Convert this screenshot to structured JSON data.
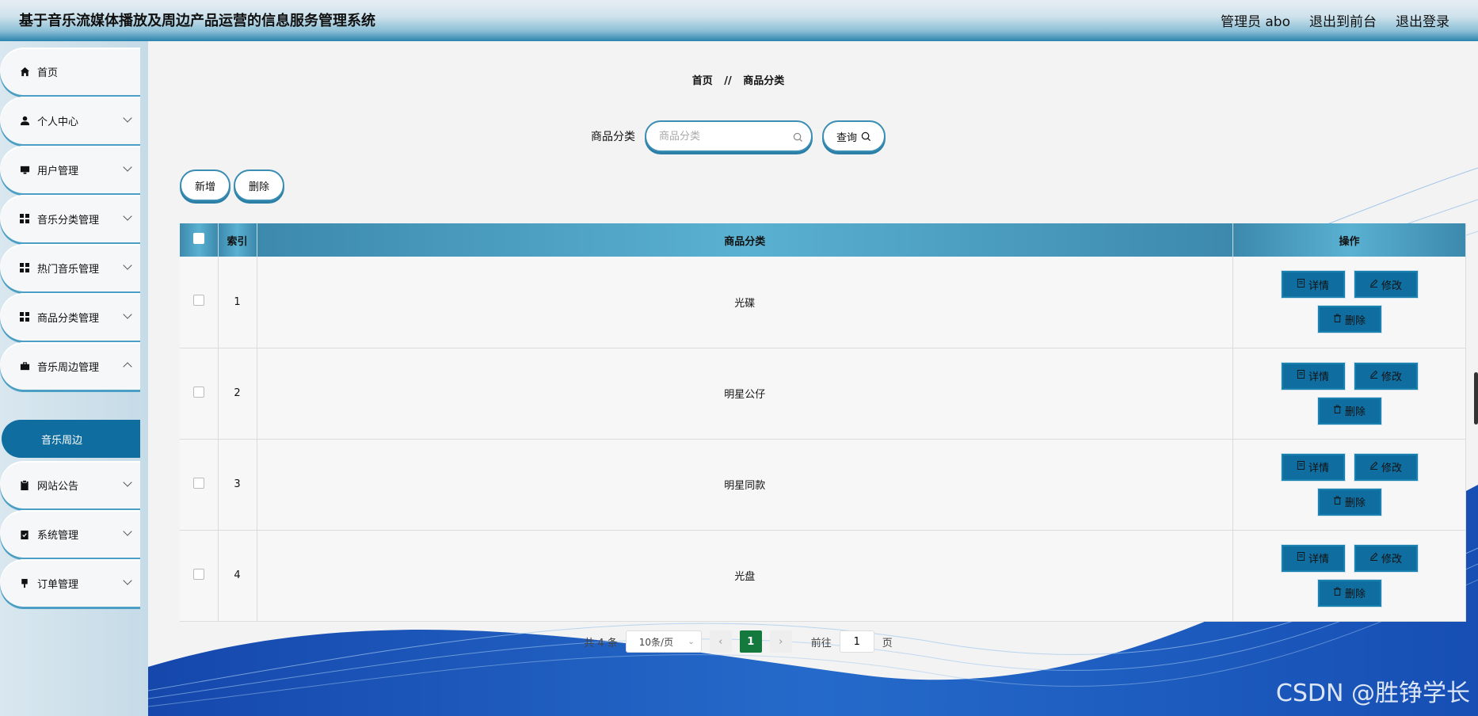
{
  "header": {
    "title": "基于音乐流媒体播放及周边产品运营的信息服务管理系统",
    "user": "管理员 abo",
    "to_front": "退出到前台",
    "logout": "退出登录"
  },
  "sidebar": {
    "items": [
      {
        "label": "首页",
        "icon": "home-icon"
      },
      {
        "label": "个人中心",
        "icon": "user-icon"
      },
      {
        "label": "用户管理",
        "icon": "monitor-icon"
      },
      {
        "label": "音乐分类管理",
        "icon": "grid-icon"
      },
      {
        "label": "热门音乐管理",
        "icon": "grid-icon"
      },
      {
        "label": "商品分类管理",
        "icon": "grid-icon"
      },
      {
        "label": "音乐周边管理",
        "icon": "briefcase-icon"
      },
      {
        "label": "网站公告",
        "icon": "clipboard-icon"
      },
      {
        "label": "系统管理",
        "icon": "clipboard-check-icon"
      },
      {
        "label": "订单管理",
        "icon": "pin-icon"
      }
    ],
    "active_sub": "音乐周边"
  },
  "breadcrumb": {
    "home": "首页",
    "separator": "//",
    "current": "商品分类"
  },
  "search": {
    "label": "商品分类",
    "placeholder": "商品分类",
    "button": "查询"
  },
  "actions": {
    "add": "新增",
    "delete": "删除"
  },
  "table": {
    "headers": {
      "index": "索引",
      "category": "商品分类",
      "ops": "操作"
    },
    "rows": [
      {
        "index": "1",
        "category": "光碟"
      },
      {
        "index": "2",
        "category": "明星公仔"
      },
      {
        "index": "3",
        "category": "明星同款"
      },
      {
        "index": "4",
        "category": "光盘"
      }
    ],
    "op_labels": {
      "detail": "详情",
      "edit": "修改",
      "delete": "删除"
    }
  },
  "pagination": {
    "total": "共 4 条",
    "page_size": "10条/页",
    "current_page": "1",
    "goto_label": "前往",
    "goto_value": "1",
    "page_suffix": "页"
  },
  "watermark": "CSDN @胜铮学长",
  "colors": {
    "accent": "#0f6e9f",
    "header_row": "#4aa3c7",
    "active_page": "#13793d"
  }
}
